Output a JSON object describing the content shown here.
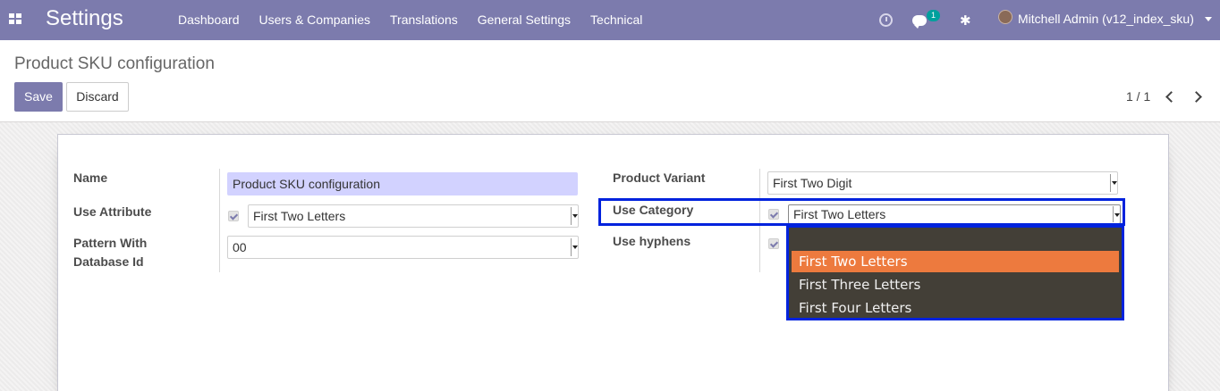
{
  "navbar": {
    "brand": "Settings",
    "menu": [
      "Dashboard",
      "Users & Companies",
      "Translations",
      "General Settings",
      "Technical"
    ],
    "chat_badge": "1",
    "user": "Mitchell Admin (v12_index_sku)"
  },
  "control_panel": {
    "title": "Product SKU configuration",
    "save_label": "Save",
    "discard_label": "Discard",
    "pager": "1 / 1"
  },
  "form": {
    "left": {
      "name_label": "Name",
      "name_value": "Product SKU configuration",
      "use_attribute_label": "Use Attribute",
      "use_attribute_value": "First Two Letters",
      "pattern_label_line1": "Pattern With",
      "pattern_label_line2": "Database Id",
      "pattern_value": "00"
    },
    "right": {
      "product_variant_label": "Product Variant",
      "product_variant_value": "First Two Digit",
      "use_category_label": "Use Category",
      "use_category_value": "First Two Letters",
      "use_hyphens_label": "Use hyphens"
    }
  },
  "dropdown": {
    "options": [
      "",
      "First Two Letters",
      "First Three Letters",
      "First Four Letters"
    ],
    "selected": "First Two Letters"
  },
  "colors": {
    "navbar": "#7c7bad",
    "highlight_box": "#0022dd",
    "dropdown_bg": "#433f37",
    "dropdown_active": "#ed7a3e",
    "name_field_bg": "#d2d2ff"
  }
}
